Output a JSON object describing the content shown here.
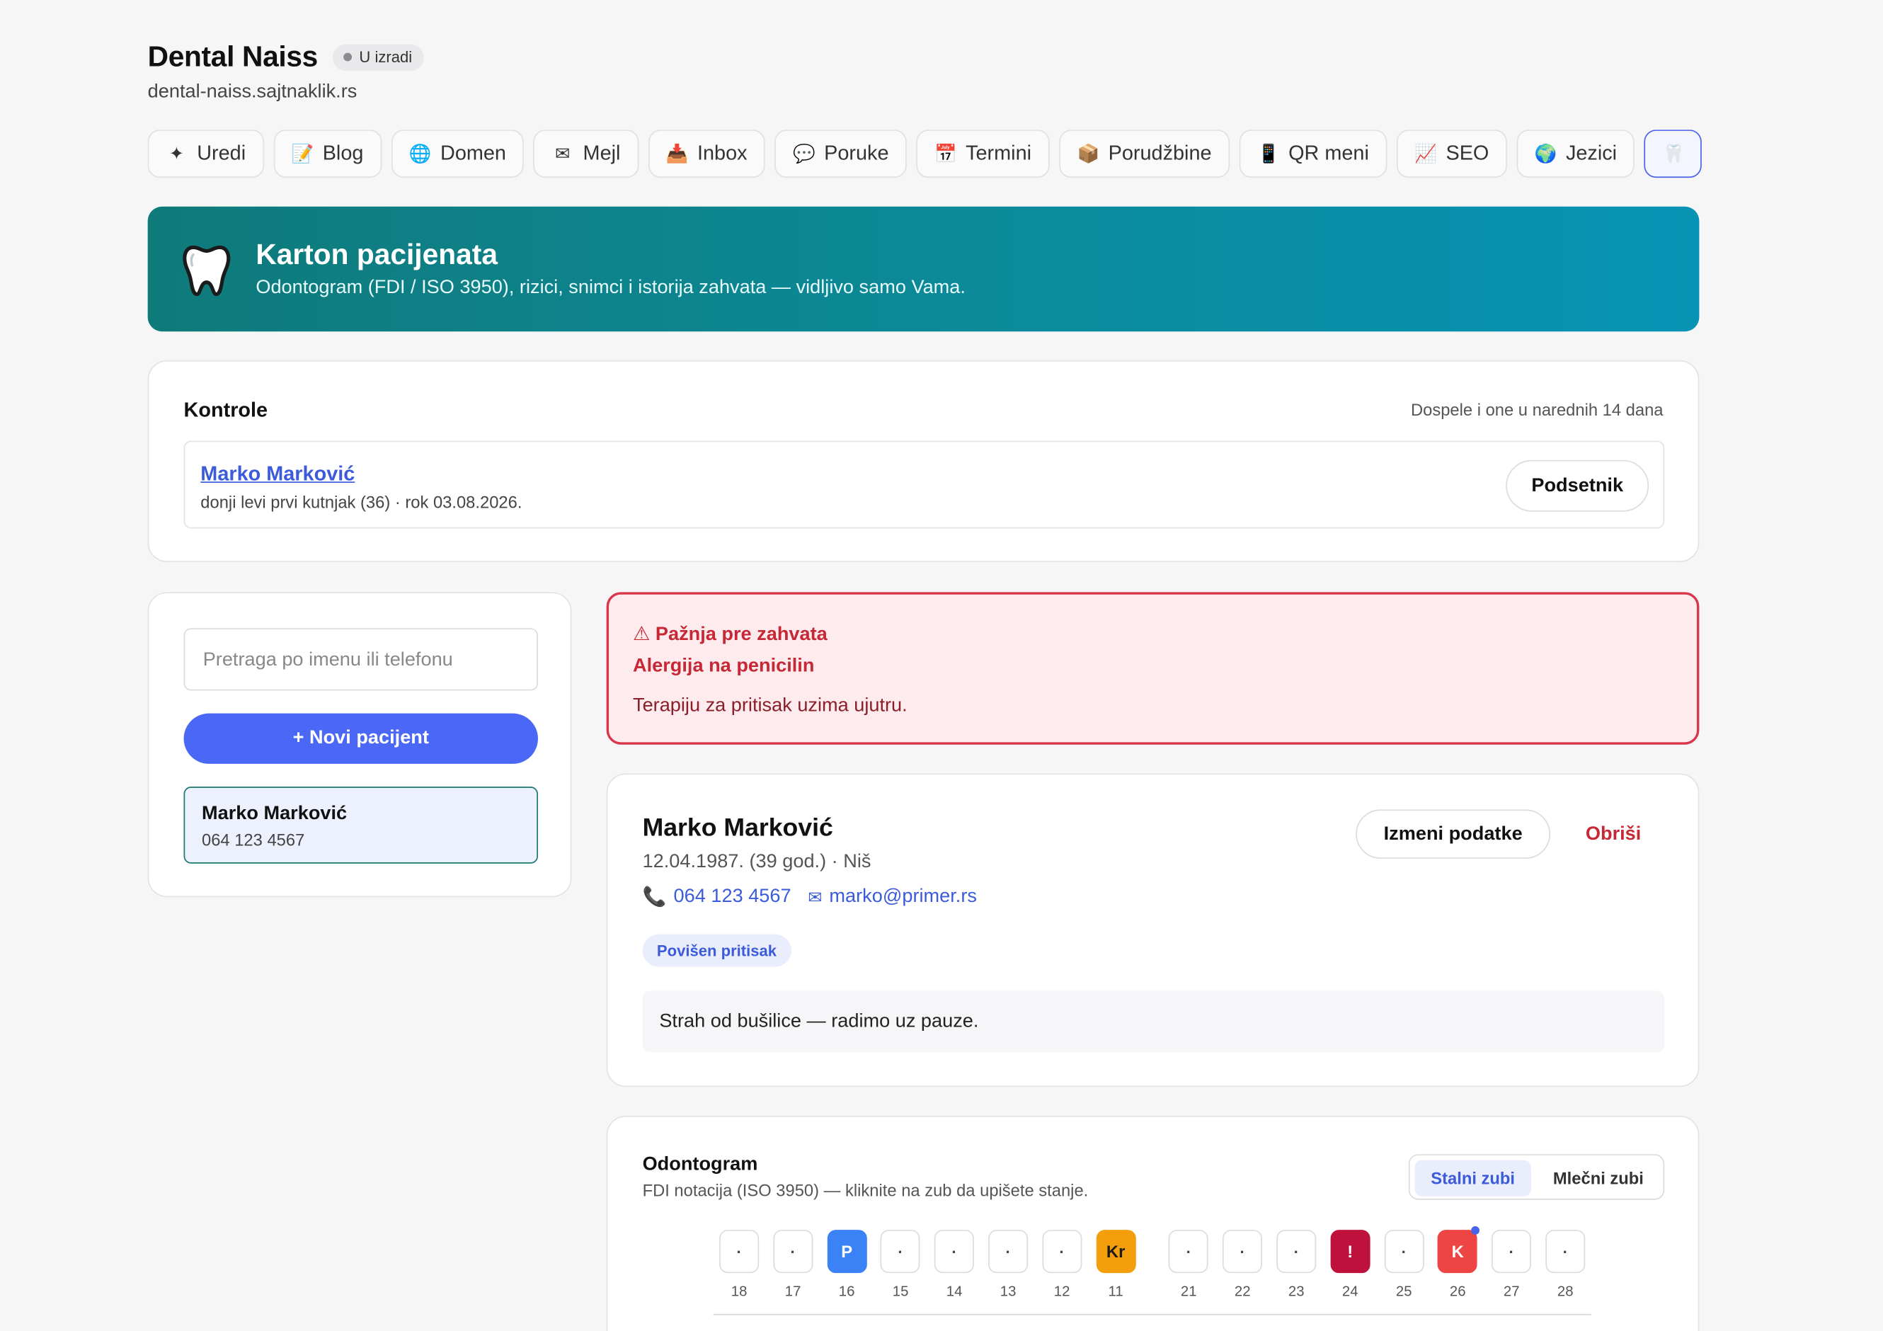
{
  "site": {
    "title": "Dental Naiss",
    "status": "U izradi",
    "url": "dental-naiss.sajtnaklik.rs"
  },
  "tabs": [
    {
      "label": "Uredi",
      "icon": "✦",
      "icon_name": "sparkle-icon"
    },
    {
      "label": "Blog",
      "icon": "📝",
      "icon_name": "memo-icon"
    },
    {
      "label": "Domen",
      "icon": "🌐",
      "icon_name": "globe-icon"
    },
    {
      "label": "Mejl",
      "icon": "✉",
      "icon_name": "envelope-icon"
    },
    {
      "label": "Inbox",
      "icon": "📥",
      "icon_name": "inbox-tray-icon"
    },
    {
      "label": "Poruke",
      "icon": "💬",
      "icon_name": "speech-bubble-icon"
    },
    {
      "label": "Termini",
      "icon": "📅",
      "icon_name": "calendar-icon"
    },
    {
      "label": "Porudžbine",
      "icon": "📦",
      "icon_name": "package-icon"
    },
    {
      "label": "QR meni",
      "icon": "📱",
      "icon_name": "mobile-phone-icon"
    },
    {
      "label": "SEO",
      "icon": "📈",
      "icon_name": "chart-icon"
    },
    {
      "label": "Jezici",
      "icon": "🌍",
      "icon_name": "earth-icon"
    },
    {
      "label": "",
      "icon": "🦷",
      "icon_name": "tooth-icon"
    }
  ],
  "banner": {
    "title": "Karton pacijenata",
    "subtitle": "Odontogram (FDI / ISO 3950), rizici, snimci i istorija zahvata — vidljivo samo Vama."
  },
  "kontrole": {
    "title": "Kontrole",
    "note": "Dospele i one u narednih 14 dana",
    "item": {
      "name": "Marko Marković",
      "desc": "donji levi prvi kutnjak (36) · rok 03.08.2026.",
      "button": "Podsetnik"
    }
  },
  "sidebar": {
    "search_placeholder": "Pretraga po imenu ili telefonu",
    "new_button": "+ Novi pacijent",
    "patients": [
      {
        "name": "Marko Marković",
        "phone": "064 123 4567"
      }
    ]
  },
  "alert": {
    "title": "⚠ Pažnja pre zahvata",
    "allergy": "Alergija na penicilin",
    "note": "Terapiju za pritisak uzima ujutru."
  },
  "patient": {
    "name": "Marko Marković",
    "meta": "12.04.1987. (39 god.) · Niš",
    "phone": "064 123 4567",
    "email": "marko@primer.rs",
    "tag": "Povišen pritisak",
    "note": "Strah od bušilice — radimo uz pauze.",
    "edit_button": "Izmeni podatke",
    "delete_button": "Obriši"
  },
  "odontogram": {
    "title": "Odontogram",
    "subtitle": "FDI notacija (ISO 3950) — kliknite na zub da upišete stanje.",
    "toggle": [
      "Stalni zubi",
      "Mlečni zubi"
    ],
    "upper_teeth": [
      {
        "n": "18",
        "mark": "·",
        "bg": "",
        "fg": ""
      },
      {
        "n": "17",
        "mark": "·",
        "bg": "",
        "fg": ""
      },
      {
        "n": "16",
        "mark": "P",
        "bg": "#3b82f6",
        "fg": "#ffffff"
      },
      {
        "n": "15",
        "mark": "·",
        "bg": "",
        "fg": ""
      },
      {
        "n": "14",
        "mark": "·",
        "bg": "",
        "fg": ""
      },
      {
        "n": "13",
        "mark": "·",
        "bg": "",
        "fg": ""
      },
      {
        "n": "12",
        "mark": "·",
        "bg": "",
        "fg": ""
      },
      {
        "n": "11",
        "mark": "Kr",
        "bg": "#f59e0b",
        "fg": "#1a1a1a"
      },
      {
        "n": "21",
        "mark": "·",
        "bg": "",
        "fg": ""
      },
      {
        "n": "22",
        "mark": "·",
        "bg": "",
        "fg": ""
      },
      {
        "n": "23",
        "mark": "·",
        "bg": "",
        "fg": ""
      },
      {
        "n": "24",
        "mark": "!",
        "bg": "#be123c",
        "fg": "#ffffff"
      },
      {
        "n": "25",
        "mark": "·",
        "bg": "",
        "fg": ""
      },
      {
        "n": "26",
        "mark": "K",
        "bg": "#ef4444",
        "fg": "#ffffff",
        "dot": true
      },
      {
        "n": "27",
        "mark": "·",
        "bg": "",
        "fg": ""
      },
      {
        "n": "28",
        "mark": "·",
        "bg": "",
        "fg": ""
      }
    ]
  }
}
